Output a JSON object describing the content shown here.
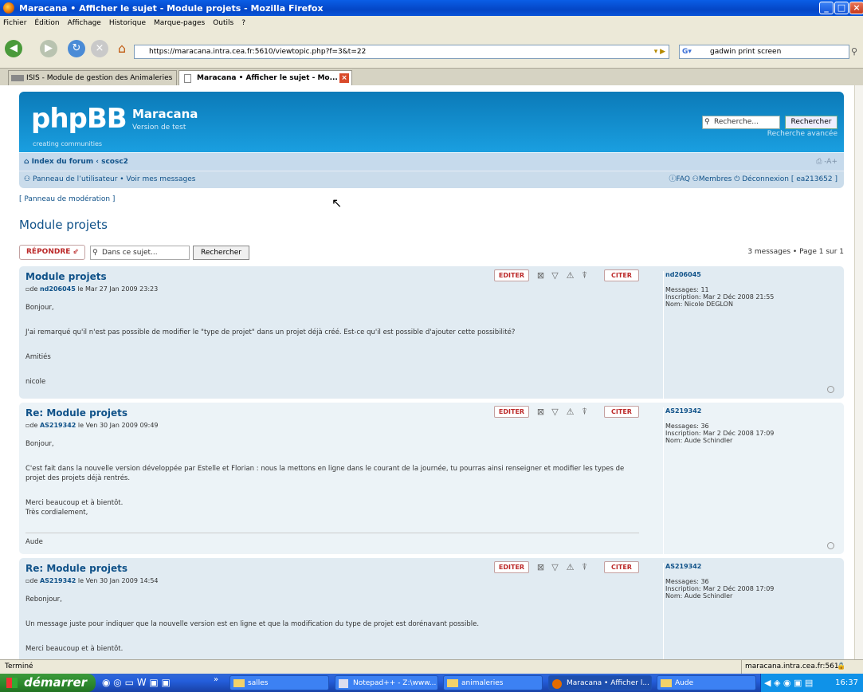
{
  "window": {
    "title": "Maracana • Afficher le sujet - Module projets - Mozilla Firefox"
  },
  "menu": [
    "Fichier",
    "Édition",
    "Affichage",
    "Historique",
    "Marque-pages",
    "Outils",
    "?"
  ],
  "url": "https://maracana.intra.cea.fr:5610/viewtopic.php?f=3&t=22",
  "search_engine_value": "gadwin print screen",
  "tabs": [
    {
      "label": "ISIS - Module de gestion des Animaleries"
    },
    {
      "label": "Maracana • Afficher le sujet - Mo..."
    }
  ],
  "forum": {
    "logo": "phpBB",
    "logo_tagline": "creating   communities",
    "site_name": "Maracana",
    "site_desc": "Version de test",
    "search_placeholder": "Recherche...",
    "search_button": "Rechercher",
    "advanced_search": "Recherche avancée",
    "breadcrumb": "Index du forum ‹ scosc2",
    "user_panel": "Panneau de l’utilisateur • Voir mes messages",
    "faq": "FAQ",
    "members": "Membres",
    "logout": "Déconnexion [ ea213652 ]",
    "mod_panel": "[ Panneau de modération ]",
    "topic_title": "Module projets",
    "reply_button": "RÉPONDRE",
    "topic_search_placeholder": "Dans ce sujet...",
    "topic_search_button": "Rechercher",
    "pagination": "3 messages • Page 1 sur 1",
    "edit_label": "EDITER",
    "quote_label": "CITER"
  },
  "posts": [
    {
      "title": "Module projets",
      "author": "nd206045",
      "date": "le Mar 27 Jan 2009 23:23",
      "body": [
        "Bonjour,",
        "J'ai remarqué qu'il n'est pas possible de modifier le \"type de projet\" dans un projet déjà créé. Est-ce qu'il est possible d'ajouter cette possibilité?",
        "Amitiés",
        "nicole"
      ],
      "profile": {
        "name": "nd206045",
        "messages": "Messages: 11",
        "inscription": "Inscription: Mar 2 Déc 2008 21:55",
        "nom": "Nom: Nicole DEGLON"
      }
    },
    {
      "title": "Re: Module projets",
      "author": "AS219342",
      "date": "le Ven 30 Jan 2009 09:49",
      "body": [
        "Bonjour,",
        "C'est fait dans la nouvelle version développée par Estelle et Florian : nous la mettons en ligne dans le courant de la journée, tu pourras ainsi renseigner et modifier les types de projet des projets déjà rentrés.",
        "Merci beaucoup et à bientôt.",
        "Très cordialement,"
      ],
      "signature": "Aude",
      "profile": {
        "name": "AS219342",
        "messages": "Messages: 36",
        "inscription": "Inscription: Mar 2 Déc 2008 17:09",
        "nom": "Nom: Aude Schindler"
      }
    },
    {
      "title": "Re: Module projets",
      "author": "AS219342",
      "date": "le Ven 30 Jan 2009 14:54",
      "body": [
        "Rebonjour,",
        "Un message juste pour indiquer que la nouvelle version est en ligne et que la modification du type de projet est dorénavant possible.",
        "Merci beaucoup et à bientôt."
      ],
      "profile": {
        "name": "AS219342",
        "messages": "Messages: 36",
        "inscription": "Inscription: Mar 2 Déc 2008 17:09",
        "nom": "Nom: Aude Schindler"
      }
    }
  ],
  "status": {
    "left": "Terminé",
    "right": "maracana.intra.cea.fr:5610"
  },
  "taskbar": {
    "start": "démarrer",
    "tasks": [
      "salles",
      "Notepad++ - Z:\\www...",
      "animaleries",
      "Maracana • Afficher l...",
      "Aude"
    ],
    "clock": "16:37"
  }
}
